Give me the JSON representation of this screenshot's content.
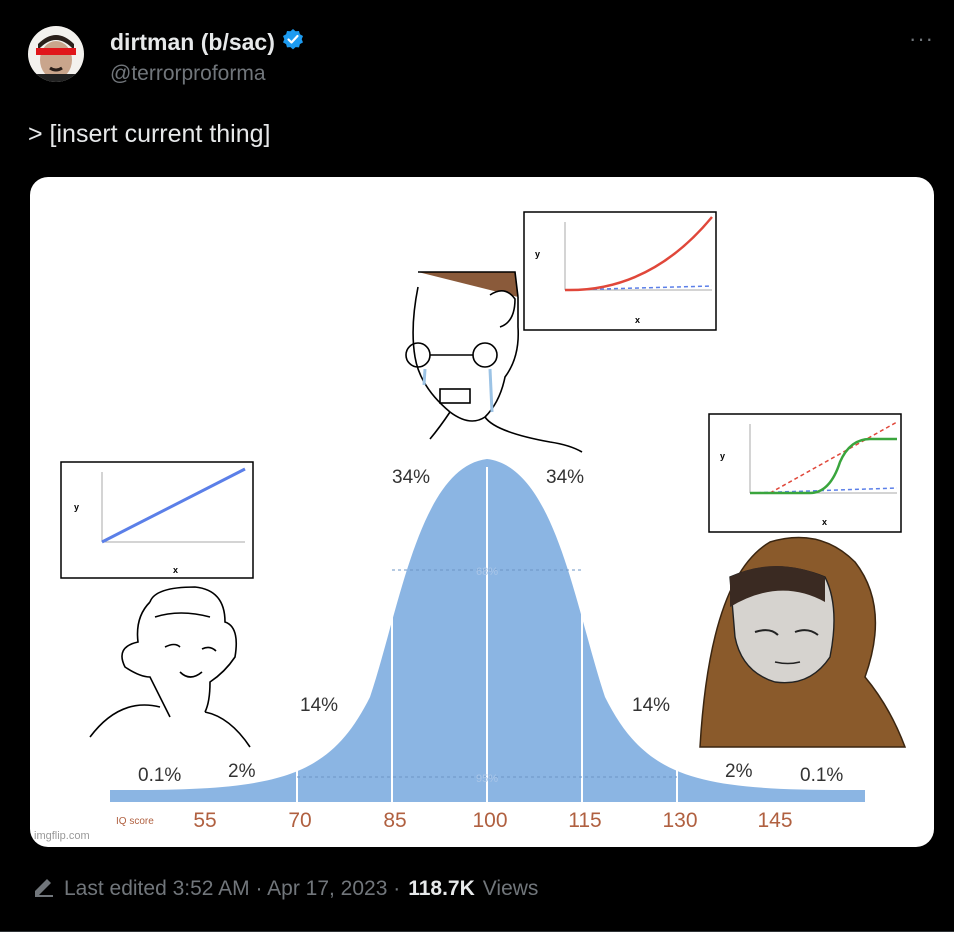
{
  "tweet": {
    "display_name": "dirtman (b/sac)",
    "handle": "@terrorproforma",
    "more_label": "···",
    "text": "> [insert current thing]",
    "footer": {
      "edited": "Last edited 3:52 AM · Apr 17, 2023 ·",
      "views_count": "118.7K",
      "views_label": "Views"
    }
  },
  "meme": {
    "percent_labels": [
      "0.1%",
      "2%",
      "14%",
      "34%",
      "34%",
      "14%",
      "2%",
      "0.1%"
    ],
    "inner_labels": [
      "68%",
      "95%"
    ],
    "iq_label": "IQ score",
    "scores": [
      "55",
      "70",
      "85",
      "100",
      "115",
      "130",
      "145"
    ],
    "watermark": "imgflip.com",
    "plots": [
      {
        "xlabel": "x",
        "ylabel": "y"
      },
      {
        "xlabel": "x",
        "ylabel": "y"
      },
      {
        "xlabel": "x",
        "ylabel": "y"
      }
    ]
  },
  "colors": {
    "background": "#000000",
    "bell_curve": "#8bb5e3",
    "verified": "#1d9bf0",
    "censor_bar": "#e0161b",
    "linear_line": "#5b7fe8",
    "red_line": "#e0473a",
    "green_line": "#3aa53d",
    "hood": "#8a5a2b"
  }
}
